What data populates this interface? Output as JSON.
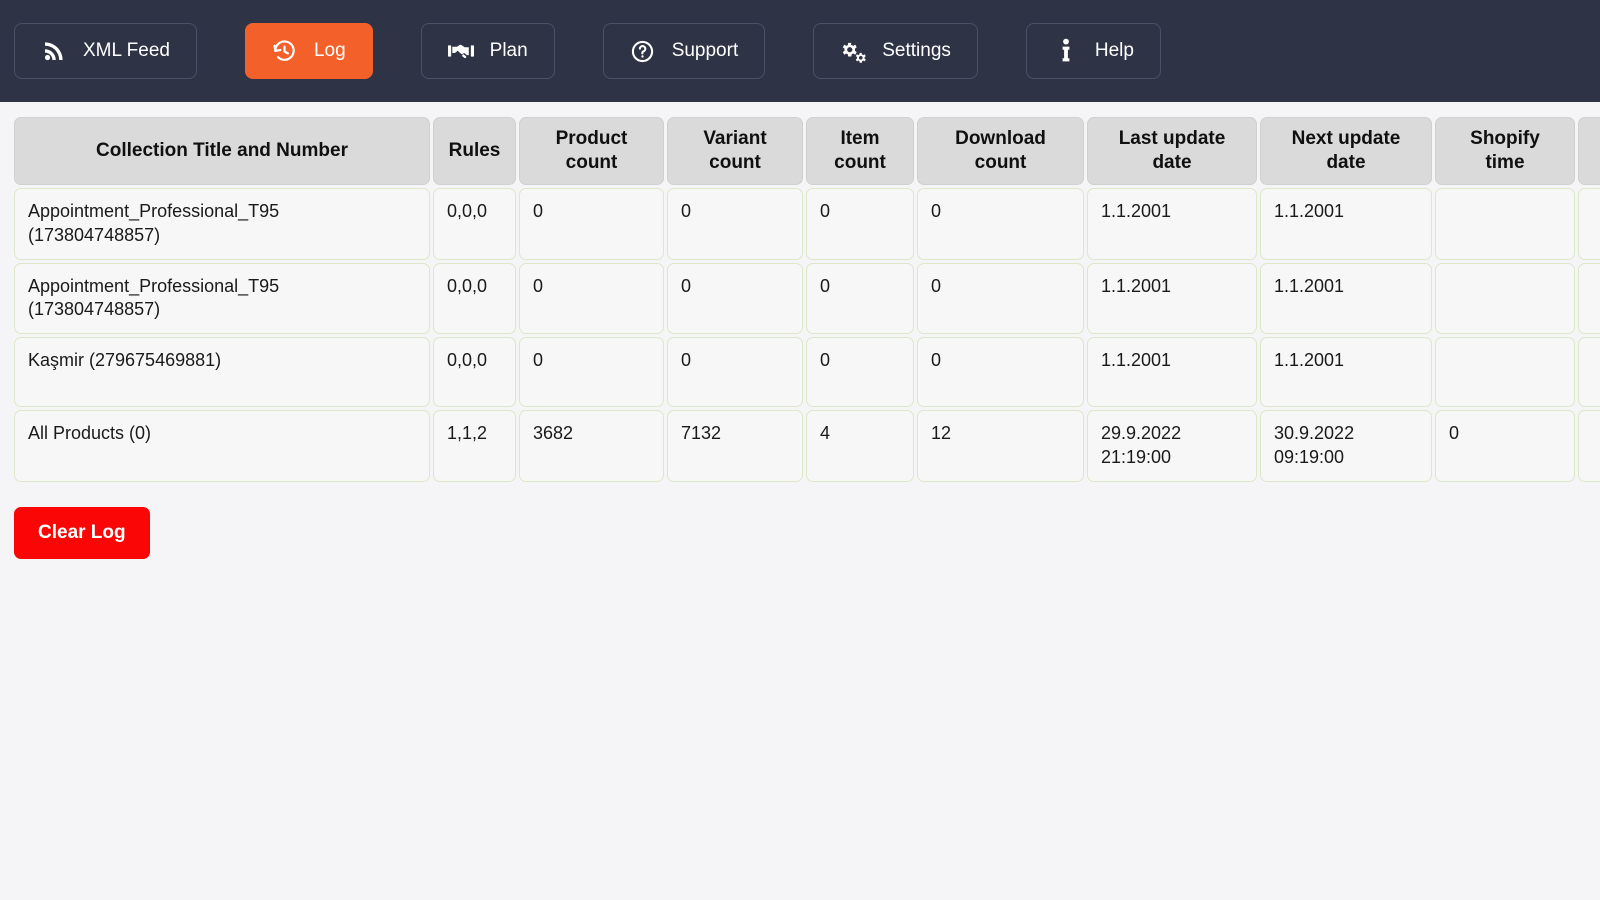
{
  "nav": {
    "background_color": "#2e3446",
    "active_color": "#f4602a",
    "items": [
      {
        "label": "XML Feed",
        "icon": "rss-icon",
        "active": false
      },
      {
        "label": "Log",
        "icon": "history-icon",
        "active": true
      },
      {
        "label": "Plan",
        "icon": "handshake-icon",
        "active": false
      },
      {
        "label": "Support",
        "icon": "question-circle-icon",
        "active": false
      },
      {
        "label": "Settings",
        "icon": "gears-icon",
        "active": false
      },
      {
        "label": "Help",
        "icon": "info-icon",
        "active": false
      }
    ]
  },
  "table": {
    "headers": [
      "Collection Title and Number",
      "Rules",
      "Product\ncount",
      "Variant\ncount",
      "Item\ncount",
      "Download\ncount",
      "Last update\ndate",
      "Next update\ndate",
      "Shopify\ntime",
      ""
    ],
    "rows": [
      {
        "title": "Appointment_Professional_T95 (173804748857)",
        "rules": "0,0,0",
        "product_count": "0",
        "variant_count": "0",
        "item_count": "0",
        "download_count": "0",
        "last_update_date": "1.1.2001",
        "next_update_date": "1.1.2001",
        "shopify_time": "",
        "extra": ""
      },
      {
        "title": "Appointment_Professional_T95 (173804748857)",
        "rules": "0,0,0",
        "product_count": "0",
        "variant_count": "0",
        "item_count": "0",
        "download_count": "0",
        "last_update_date": "1.1.2001",
        "next_update_date": "1.1.2001",
        "shopify_time": "",
        "extra": ""
      },
      {
        "title": "Kaşmir (279675469881)",
        "rules": "0,0,0",
        "product_count": "0",
        "variant_count": "0",
        "item_count": "0",
        "download_count": "0",
        "last_update_date": "1.1.2001",
        "next_update_date": "1.1.2001",
        "shopify_time": "",
        "extra": ""
      },
      {
        "title": "All Products (0)",
        "rules": "1,1,2",
        "product_count": "3682",
        "variant_count": "7132",
        "item_count": "4",
        "download_count": "12",
        "last_update_date": "29.9.2022\n21:19:00",
        "next_update_date": "30.9.2022\n09:19:00",
        "shopify_time": "0",
        "extra": ""
      }
    ]
  },
  "actions": {
    "clear_log_label": "Clear Log",
    "clear_log_color": "#fa0606"
  }
}
